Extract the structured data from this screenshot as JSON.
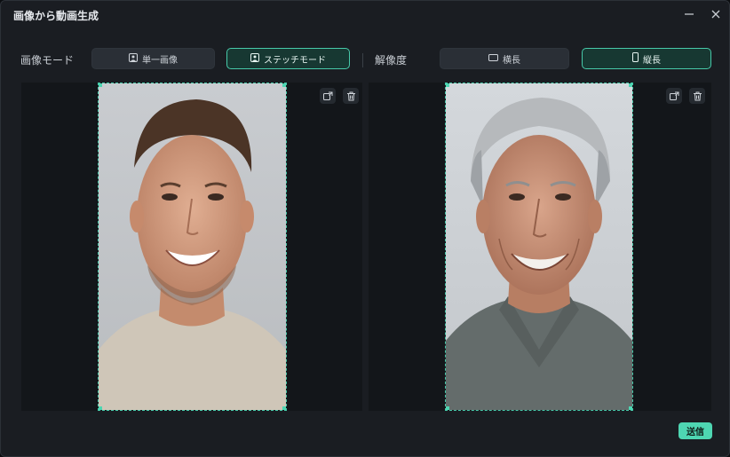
{
  "window": {
    "title": "画像から動画生成"
  },
  "mode": {
    "label": "画像モード",
    "options": [
      {
        "label": "単一画像",
        "icon": "person-image-icon",
        "selected": false
      },
      {
        "label": "ステッチモード",
        "icon": "person-image-icon",
        "selected": true
      }
    ]
  },
  "resolution": {
    "label": "解像度",
    "options": [
      {
        "label": "横長",
        "icon": "landscape-icon",
        "selected": false
      },
      {
        "label": "縦長",
        "icon": "portrait-icon",
        "selected": true
      }
    ]
  },
  "images": [
    {
      "subject": "young-man-photo",
      "tools": [
        "replace-icon",
        "trash-icon"
      ]
    },
    {
      "subject": "older-man-photo",
      "tools": [
        "replace-icon",
        "trash-icon"
      ]
    }
  ],
  "footer": {
    "submit_label": "送信"
  },
  "colors": {
    "accent": "#4ed6b2",
    "background": "#1a1d22",
    "panel": "#13161a"
  }
}
